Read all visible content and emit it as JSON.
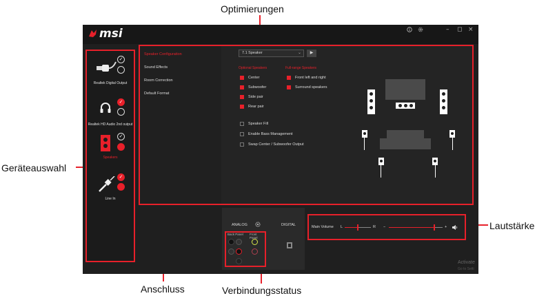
{
  "callouts": {
    "optimierungen": "Optimierungen",
    "geraeteauswahl": "Geräteauswahl",
    "lautstaerke": "Lautstärke",
    "anschluss": "Anschluss",
    "verbindungsstatus": "Verbindungsstatus"
  },
  "app": {
    "logo": "msi",
    "title_icons": [
      "info-icon",
      "gear-icon"
    ],
    "window_buttons": {
      "minimize": "–",
      "maximize": "◻",
      "close": "×"
    }
  },
  "devices": [
    {
      "label": "Realtek Digital Output",
      "selected": false
    },
    {
      "label": "Realtek HD Audio 2nd output",
      "selected": false
    },
    {
      "label": "Speakers",
      "selected": true
    },
    {
      "label": "Line In",
      "selected": false
    }
  ],
  "tabs": [
    {
      "label": "Speaker Configuration",
      "active": true
    },
    {
      "label": "Sound Effects",
      "active": false
    },
    {
      "label": "Room Correction",
      "active": false
    },
    {
      "label": "Default Format",
      "active": false
    }
  ],
  "config": {
    "speaker_select": "7.1 Speaker",
    "play_button": "▶",
    "optional_header": "Optional Speakers",
    "fullrange_header": "Full-range Speakers",
    "optional": [
      {
        "label": "Center",
        "checked": true
      },
      {
        "label": "Subwoofer",
        "checked": true
      },
      {
        "label": "Side pair",
        "checked": true
      },
      {
        "label": "Rear pair",
        "checked": true
      }
    ],
    "fullrange": [
      {
        "label": "Front left and right",
        "checked": true
      },
      {
        "label": "Surround speakers",
        "checked": true
      }
    ],
    "extras": [
      {
        "label": "Speaker Fill",
        "checked": false
      },
      {
        "label": "Enable Bass Management",
        "checked": false
      },
      {
        "label": "Swap Center / Subwoofer Output",
        "checked": false
      }
    ]
  },
  "connector": {
    "analog": "ANALOG",
    "digital": "DIGITAL",
    "back_panel": "Back Panel",
    "front_panel": "Front Panel"
  },
  "volume": {
    "label": "Main Volume",
    "left": "L",
    "right": "R",
    "minus": "−",
    "plus": "+",
    "balance_level": 0.5,
    "volume_level": 0.85
  },
  "watermark": {
    "line1": "Activate",
    "line2": "Go to Setti"
  },
  "colors": {
    "accent": "#e8202a",
    "background": "#1f1f1f",
    "panel": "#242424"
  }
}
